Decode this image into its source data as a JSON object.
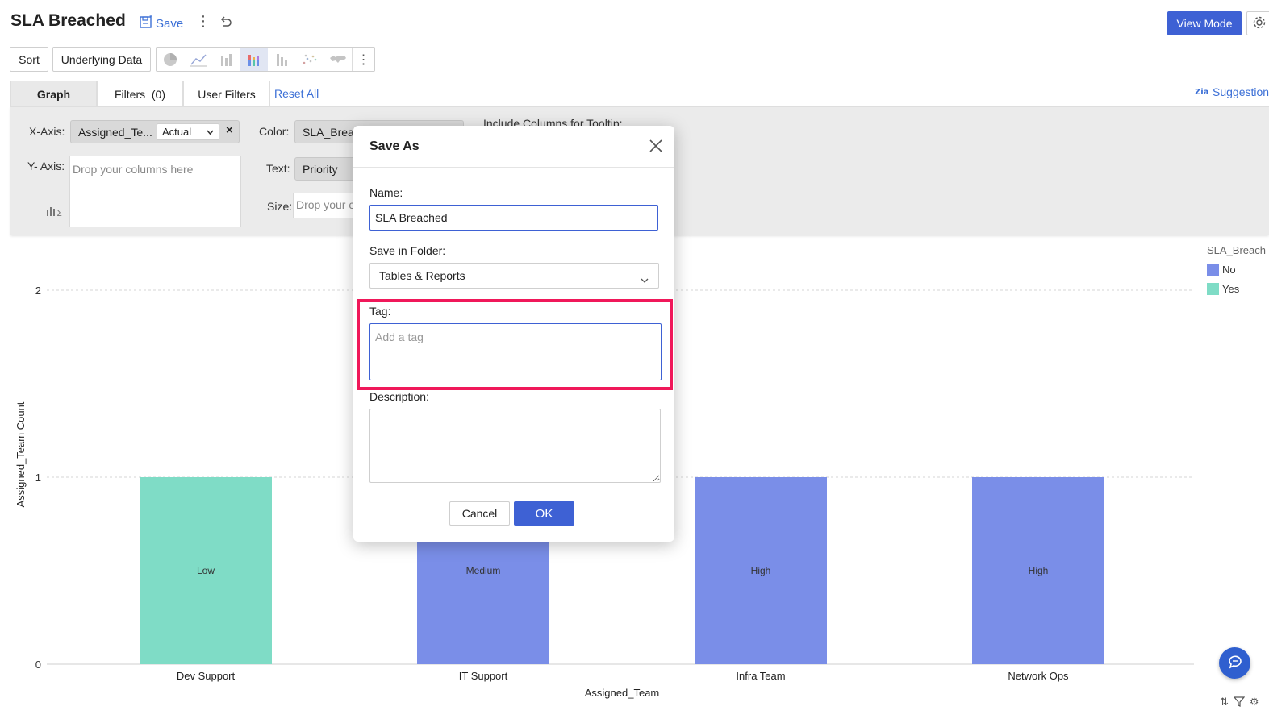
{
  "header": {
    "title": "SLA Breached",
    "save_label": "Save",
    "view_mode_label": "View Mode"
  },
  "toolbar": {
    "sort_label": "Sort",
    "underlying_data_label": "Underlying Data",
    "chart_type_icons": [
      "pie-chart-icon",
      "line-chart-icon",
      "bar-chart-icon",
      "stacked-bar-chart-icon",
      "column-chart-icon",
      "scatter-chart-icon",
      "map-chart-icon"
    ],
    "active_chart_type": "stacked-bar-chart-icon"
  },
  "tabs": {
    "graph": "Graph",
    "filters": "Filters  (0)",
    "user_filters": "User Filters",
    "reset_all": "Reset All",
    "suggestion": "Suggestion"
  },
  "shelves": {
    "x_axis_label": "X-Axis:",
    "x_axis_column": "Assigned_Te...",
    "x_axis_agg": "Actual",
    "y_axis_label": "Y- Axis:",
    "y_axis_placeholder": "Drop your columns here",
    "color_label": "Color:",
    "color_column": "SLA_Brea",
    "text_label": "Text:",
    "text_column": "Priority",
    "size_label": "Size:",
    "size_placeholder": "Drop your c",
    "tooltip_label": "Include Columns for Tooltip:"
  },
  "legend": {
    "title": "SLA_Breach",
    "items": [
      {
        "label": "No",
        "color": "#7a8ee8"
      },
      {
        "label": "Yes",
        "color": "#7fdcc6"
      }
    ]
  },
  "chart_data": {
    "type": "bar",
    "categories": [
      "Dev Support",
      "IT Support",
      "Infra Team",
      "Network Ops"
    ],
    "values": [
      1,
      1,
      1,
      1
    ],
    "bar_labels": [
      "Low",
      "Medium",
      "High",
      "High"
    ],
    "bar_series": [
      "Yes",
      "No",
      "No",
      "No"
    ],
    "xlabel": "Assigned_Team",
    "ylabel": "Assigned_Team Count",
    "ylim": [
      0,
      2
    ],
    "yticks": [
      "0",
      "1",
      "2"
    ],
    "grid": true
  },
  "modal": {
    "title": "Save As",
    "name_label": "Name:",
    "name_value": "SLA Breached",
    "folder_label": "Save in Folder:",
    "folder_value": "Tables & Reports",
    "tag_label": "Tag:",
    "tag_placeholder": "Add a tag",
    "description_label": "Description:",
    "cancel_label": "Cancel",
    "ok_label": "OK",
    "highlight_color": "#f0185a"
  }
}
